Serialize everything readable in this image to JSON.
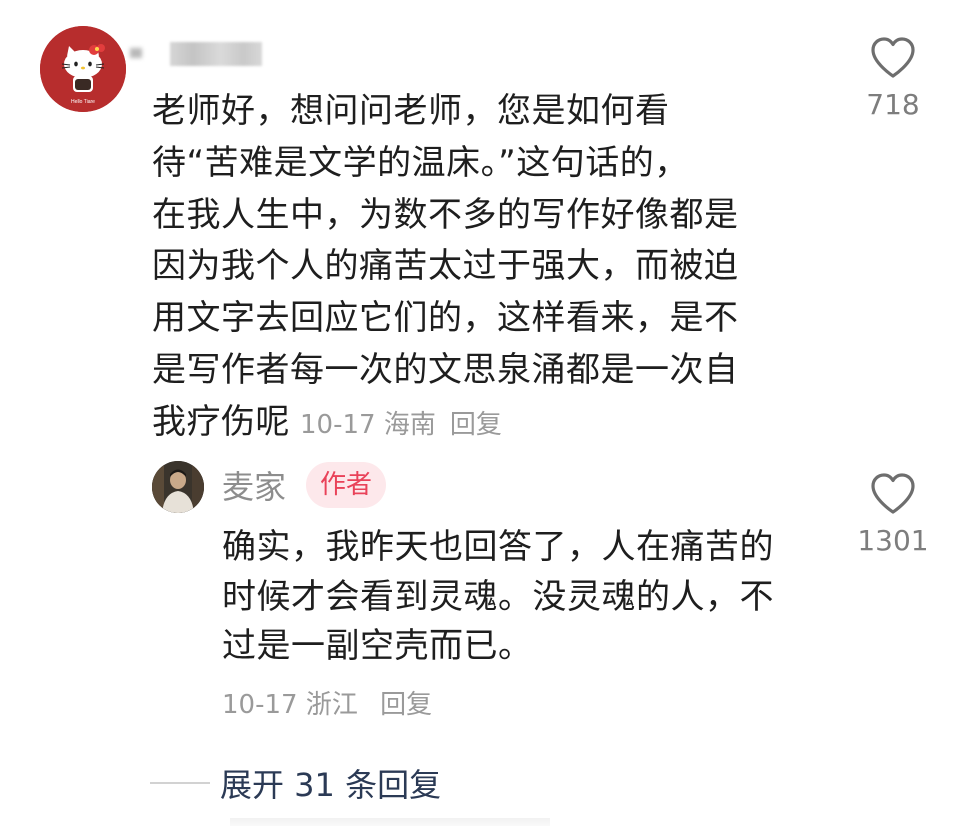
{
  "comment": {
    "lines": [
      "老师好，想问问老师，您是如何看",
      "待“苦难是文学的温床。”这句话的，",
      "在我人生中，为数不多的写作好像都是",
      "因为我个人的痛苦太过于强大，而被迫",
      "用文字去回应它们的，这样看来，是不",
      "是写作者每一次的文思泉涌都是一次自",
      "我疗伤呢"
    ],
    "date": "10-17",
    "location": "海南",
    "reply_label": "回复",
    "like_count": "718",
    "avatar_caption": "Hello Tiare"
  },
  "reply": {
    "author": "麦家",
    "badge": "作者",
    "lines": [
      "确实，我昨天也回答了，人在痛苦的",
      "时候才会看到灵魂。没灵魂的人，不",
      "过是一副空壳而已。"
    ],
    "date": "10-17",
    "location": "浙江",
    "reply_label": "回复",
    "like_count": "1301"
  },
  "expand": {
    "label": "展开 31 条回复"
  },
  "colors": {
    "avatar_bg": "#b72d2d",
    "badge_bg": "#fde8eb",
    "badge_text": "#e94259",
    "meta_text": "#9a9a9a",
    "expand_text": "#2b3a55"
  },
  "icons": {
    "like": "heart-outline-icon"
  }
}
